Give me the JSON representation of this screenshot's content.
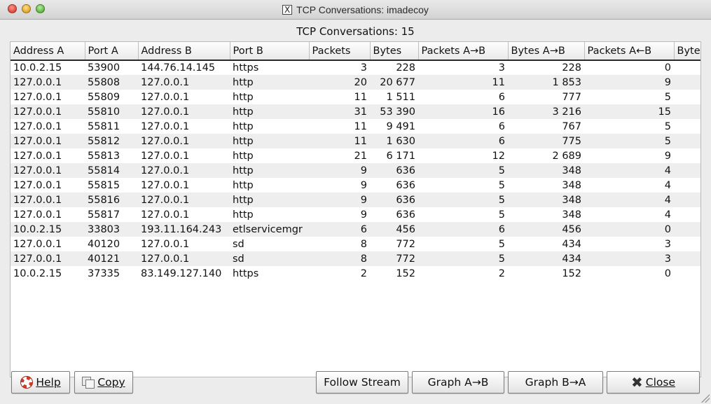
{
  "window": {
    "title": "TCP Conversations: imadecoy",
    "title_icon": "x11-icon"
  },
  "heading": "TCP Conversations: 15",
  "columns": [
    "Address A",
    "Port A",
    "Address B",
    "Port B",
    "Packets",
    "Bytes",
    "Packets A→B",
    "Bytes A→B",
    "Packets A←B",
    "Byte"
  ],
  "rows": [
    [
      "10.0.2.15",
      "53900",
      "144.76.14.145",
      "https",
      "3",
      "228",
      "3",
      "228",
      "0"
    ],
    [
      "127.0.0.1",
      "55808",
      "127.0.0.1",
      "http",
      "20",
      "20 677",
      "11",
      "1 853",
      "9"
    ],
    [
      "127.0.0.1",
      "55809",
      "127.0.0.1",
      "http",
      "11",
      "1 511",
      "6",
      "777",
      "5"
    ],
    [
      "127.0.0.1",
      "55810",
      "127.0.0.1",
      "http",
      "31",
      "53 390",
      "16",
      "3 216",
      "15"
    ],
    [
      "127.0.0.1",
      "55811",
      "127.0.0.1",
      "http",
      "11",
      "9 491",
      "6",
      "767",
      "5"
    ],
    [
      "127.0.0.1",
      "55812",
      "127.0.0.1",
      "http",
      "11",
      "1 630",
      "6",
      "775",
      "5"
    ],
    [
      "127.0.0.1",
      "55813",
      "127.0.0.1",
      "http",
      "21",
      "6 171",
      "12",
      "2 689",
      "9"
    ],
    [
      "127.0.0.1",
      "55814",
      "127.0.0.1",
      "http",
      "9",
      "636",
      "5",
      "348",
      "4"
    ],
    [
      "127.0.0.1",
      "55815",
      "127.0.0.1",
      "http",
      "9",
      "636",
      "5",
      "348",
      "4"
    ],
    [
      "127.0.0.1",
      "55816",
      "127.0.0.1",
      "http",
      "9",
      "636",
      "5",
      "348",
      "4"
    ],
    [
      "127.0.0.1",
      "55817",
      "127.0.0.1",
      "http",
      "9",
      "636",
      "5",
      "348",
      "4"
    ],
    [
      "10.0.2.15",
      "33803",
      "193.11.164.243",
      "etlservicemgr",
      "6",
      "456",
      "6",
      "456",
      "0"
    ],
    [
      "127.0.0.1",
      "40120",
      "127.0.0.1",
      "sd",
      "8",
      "772",
      "5",
      "434",
      "3"
    ],
    [
      "127.0.0.1",
      "40121",
      "127.0.0.1",
      "sd",
      "8",
      "772",
      "5",
      "434",
      "3"
    ],
    [
      "10.0.2.15",
      "37335",
      "83.149.127.140",
      "https",
      "2",
      "152",
      "2",
      "152",
      "0"
    ]
  ],
  "numeric_columns": [
    4,
    5,
    6,
    7,
    8
  ],
  "scrollbar": {
    "horizontal_position": 0.0,
    "visible_fraction": 0.65
  },
  "buttons": {
    "help": {
      "label": "Help",
      "icon": "lifebuoy-icon"
    },
    "copy": {
      "label": "Copy",
      "icon": "copy-icon"
    },
    "follow_stream": {
      "label": "Follow Stream"
    },
    "graph_ab": {
      "label": "Graph A→B"
    },
    "graph_ba": {
      "label": "Graph B→A"
    },
    "close": {
      "label": "Close",
      "icon": "close-x-icon"
    }
  },
  "colors": {
    "scroll_thumb": "#3f82e6",
    "stripe": "#eeeeee",
    "header_rule": "#2a2a2a"
  }
}
